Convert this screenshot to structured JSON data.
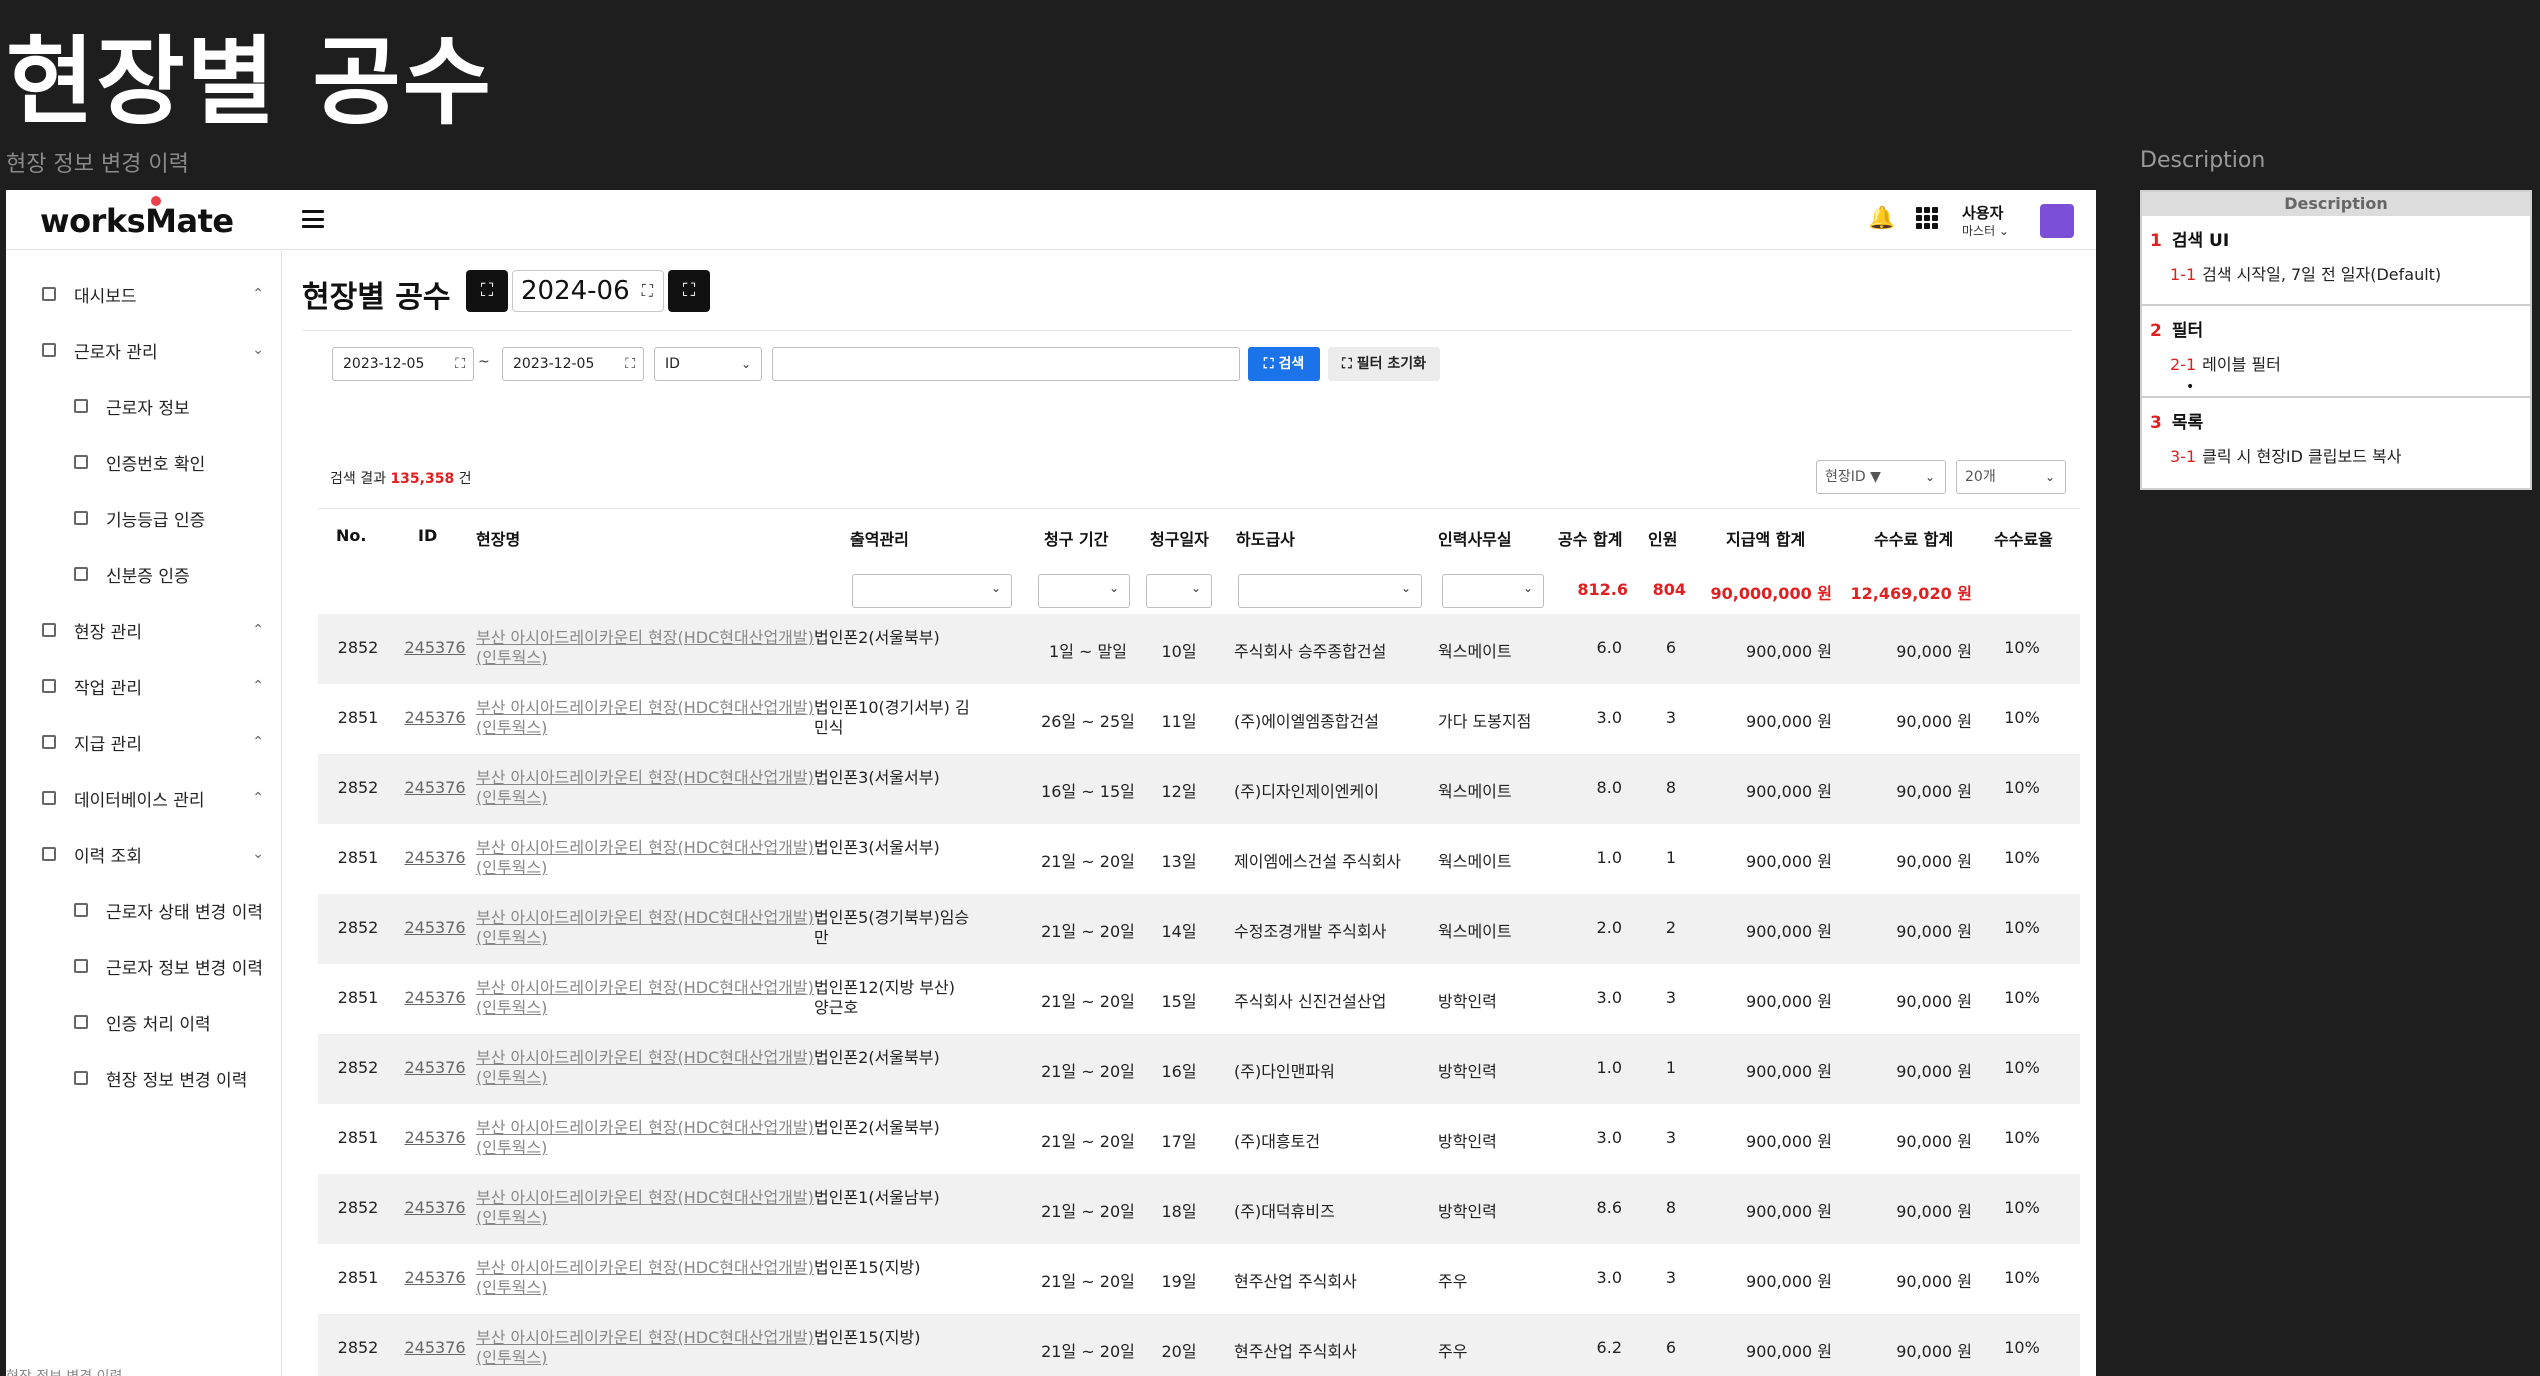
{
  "canvas": {
    "title": "현장별 공수",
    "frame_label": "현장 정보 변경 이력",
    "desc_label": "Description",
    "bottom_label": "현장 정보 변경 이력"
  },
  "topbar": {
    "logo_pre": "works",
    "logo_m": "M",
    "logo_post": "ate",
    "bell_glyph": "🔔",
    "user_name": "사용자",
    "user_role": "마스터 ⌄",
    "avatar_color": "#7b4fd6"
  },
  "sidebar": {
    "items": [
      {
        "label": "대시보드",
        "chev": "⌃"
      },
      {
        "label": "근로자 관리",
        "chev": "⌄"
      },
      {
        "label": "근로자 정보"
      },
      {
        "label": "인증번호 확인"
      },
      {
        "label": "기능등급 인증"
      },
      {
        "label": "신분증 인증"
      },
      {
        "label": "현장 관리",
        "chev": "⌃"
      },
      {
        "label": "작업 관리",
        "chev": "⌃"
      },
      {
        "label": "지급 관리",
        "chev": "⌃"
      },
      {
        "label": "데이터베이스 관리",
        "chev": "⌃"
      },
      {
        "label": "이력 조회",
        "chev": "⌄"
      },
      {
        "label": "근로자 상태 변경 이력"
      },
      {
        "label": "근로자 정보 변경 이력"
      },
      {
        "label": "인증 처리 이력"
      },
      {
        "label": "현장 정보 변경 이력"
      }
    ]
  },
  "main": {
    "title": "현장별 공수",
    "month": "2024-06",
    "icon_glyph": "⛶"
  },
  "search": {
    "start_date": "2023-12-05",
    "end_date": "2023-12-05",
    "tilde": "~",
    "field": "ID",
    "keyword": "",
    "search_label": "⛶ 검색",
    "reset_label": "⛶ 필터 초기화"
  },
  "result": {
    "prefix": "검색 결과",
    "count": "135,358",
    "suffix": "건",
    "sort": "현장ID ▼",
    "page_size": "20개"
  },
  "table": {
    "headers": [
      "No.",
      "ID",
      "현장명",
      "출역관리",
      "청구 기간",
      "청구일자",
      "하도급사",
      "인력사무실",
      "공수 합계",
      "인원",
      "지급액 합계",
      "수수료 합계",
      "수수료율"
    ],
    "totals": {
      "gongsu": "812.6",
      "people": "804",
      "paid": "90,000,000 원",
      "fee": "12,469,020 원"
    },
    "rows": [
      [
        "2852",
        "245376",
        "부산 아시아드레이카운티 현장(HDC현대산업개발)(인투웍스)",
        "법인폰2(서울북부)",
        "1일 ~ 말일",
        "10일",
        "주식회사 승주종합건설",
        "웍스메이트",
        "6.0",
        "6",
        "900,000 원",
        "90,000 원",
        "10%"
      ],
      [
        "2851",
        "245376",
        "부산 아시아드레이카운티 현장(HDC현대산업개발)(인투웍스)",
        "법인폰10(경기서부) 김민식",
        "26일 ~ 25일",
        "11일",
        "(주)에이엘엠종합건설",
        "가다 도봉지점",
        "3.0",
        "3",
        "900,000 원",
        "90,000 원",
        "10%"
      ],
      [
        "2852",
        "245376",
        "부산 아시아드레이카운티 현장(HDC현대산업개발)(인투웍스)",
        "법인폰3(서울서부)",
        "16일 ~ 15일",
        "12일",
        "(주)디자인제이엔케이",
        "웍스메이트",
        "8.0",
        "8",
        "900,000 원",
        "90,000 원",
        "10%"
      ],
      [
        "2851",
        "245376",
        "부산 아시아드레이카운티 현장(HDC현대산업개발)(인투웍스)",
        "법인폰3(서울서부)",
        "21일 ~ 20일",
        "13일",
        "제이엠에스건설 주식회사",
        "웍스메이트",
        "1.0",
        "1",
        "900,000 원",
        "90,000 원",
        "10%"
      ],
      [
        "2852",
        "245376",
        "부산 아시아드레이카운티 현장(HDC현대산업개발)(인투웍스)",
        "법인폰5(경기북부)임승만",
        "21일 ~ 20일",
        "14일",
        "수정조경개발 주식회사",
        "웍스메이트",
        "2.0",
        "2",
        "900,000 원",
        "90,000 원",
        "10%"
      ],
      [
        "2851",
        "245376",
        "부산 아시아드레이카운티 현장(HDC현대산업개발)(인투웍스)",
        "법인폰12(지방 부산) 양근호",
        "21일 ~ 20일",
        "15일",
        "주식회사 신진건설산업",
        "방학인력",
        "3.0",
        "3",
        "900,000 원",
        "90,000 원",
        "10%"
      ],
      [
        "2852",
        "245376",
        "부산 아시아드레이카운티 현장(HDC현대산업개발)(인투웍스)",
        "법인폰2(서울북부)",
        "21일 ~ 20일",
        "16일",
        "(주)다인맨파워",
        "방학인력",
        "1.0",
        "1",
        "900,000 원",
        "90,000 원",
        "10%"
      ],
      [
        "2851",
        "245376",
        "부산 아시아드레이카운티 현장(HDC현대산업개발)(인투웍스)",
        "법인폰2(서울북부)",
        "21일 ~ 20일",
        "17일",
        "(주)대흥토건",
        "방학인력",
        "3.0",
        "3",
        "900,000 원",
        "90,000 원",
        "10%"
      ],
      [
        "2852",
        "245376",
        "부산 아시아드레이카운티 현장(HDC현대산업개발)(인투웍스)",
        "법인폰1(서울남부)",
        "21일 ~ 20일",
        "18일",
        "(주)대덕휴비즈",
        "방학인력",
        "8.6",
        "8",
        "900,000 원",
        "90,000 원",
        "10%"
      ],
      [
        "2851",
        "245376",
        "부산 아시아드레이카운티 현장(HDC현대산업개발)(인투웍스)",
        "법인폰15(지방)",
        "21일 ~ 20일",
        "19일",
        "현주산업 주식회사",
        "주우",
        "3.0",
        "3",
        "900,000 원",
        "90,000 원",
        "10%"
      ],
      [
        "2852",
        "245376",
        "부산 아시아드레이카운티 현장(HDC현대산업개발)(인투웍스)",
        "법인폰15(지방)",
        "21일 ~ 20일",
        "20일",
        "현주산업 주식회사",
        "주우",
        "6.2",
        "6",
        "900,000 원",
        "90,000 원",
        "10%"
      ]
    ]
  },
  "description": {
    "head": "Description",
    "sections": [
      {
        "num": "1",
        "title": "검색 UI",
        "item_num": "1-1",
        "item": "검색 시작일, 7일 전 일자(Default)"
      },
      {
        "num": "2",
        "title": "필터",
        "item_num": "2-1",
        "item": "레이블 필터",
        "bullet": "•"
      },
      {
        "num": "3",
        "title": "목록",
        "item_num": "3-1",
        "item": "클릭 시 현장ID 클립보드 복사"
      }
    ]
  },
  "colors": {
    "accent": "#1a73e8",
    "highlight": "#e02020",
    "dark": "#111111"
  }
}
